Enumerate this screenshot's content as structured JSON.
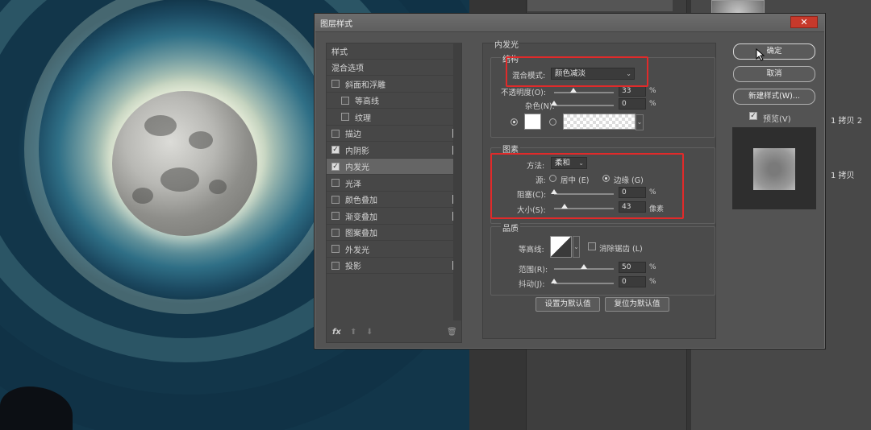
{
  "dialog": {
    "title": "图层样式",
    "close_icon": "close-icon"
  },
  "style_list": {
    "header": "样式",
    "items": [
      {
        "label": "混合选项",
        "checkbox": false,
        "checked": false,
        "plus": false,
        "indent": false,
        "selected": false
      },
      {
        "label": "斜面和浮雕",
        "checkbox": true,
        "checked": false,
        "plus": false,
        "indent": false,
        "selected": false
      },
      {
        "label": "等高线",
        "checkbox": true,
        "checked": false,
        "plus": false,
        "indent": true,
        "selected": false
      },
      {
        "label": "纹理",
        "checkbox": true,
        "checked": false,
        "plus": false,
        "indent": true,
        "selected": false
      },
      {
        "label": "描边",
        "checkbox": true,
        "checked": false,
        "plus": true,
        "indent": false,
        "selected": false
      },
      {
        "label": "内阴影",
        "checkbox": true,
        "checked": true,
        "plus": true,
        "indent": false,
        "selected": false
      },
      {
        "label": "内发光",
        "checkbox": true,
        "checked": true,
        "plus": false,
        "indent": false,
        "selected": true
      },
      {
        "label": "光泽",
        "checkbox": true,
        "checked": false,
        "plus": false,
        "indent": false,
        "selected": false
      },
      {
        "label": "颜色叠加",
        "checkbox": true,
        "checked": false,
        "plus": true,
        "indent": false,
        "selected": false
      },
      {
        "label": "渐变叠加",
        "checkbox": true,
        "checked": false,
        "plus": true,
        "indent": false,
        "selected": false
      },
      {
        "label": "图案叠加",
        "checkbox": true,
        "checked": false,
        "plus": false,
        "indent": false,
        "selected": false
      },
      {
        "label": "外发光",
        "checkbox": true,
        "checked": false,
        "plus": false,
        "indent": false,
        "selected": false
      },
      {
        "label": "投影",
        "checkbox": true,
        "checked": false,
        "plus": true,
        "indent": false,
        "selected": false
      }
    ],
    "footer": {
      "fx_label": "fx",
      "up_icon": "arrow-up-icon",
      "down_icon": "arrow-down-icon",
      "trash_icon": "trash-icon"
    }
  },
  "inner_glow": {
    "title": "内发光",
    "structure": {
      "title": "结构",
      "blend_mode_label": "混合模式:",
      "blend_mode_value": "颜色减淡",
      "opacity_label": "不透明度(O):",
      "opacity_value": "33",
      "opacity_unit": "%",
      "noise_label": "杂色(N):",
      "noise_value": "0",
      "noise_unit": "%"
    },
    "elements": {
      "title": "图素",
      "method_label": "方法:",
      "method_value": "柔和",
      "source_label": "源:",
      "source_center": "居中 (E)",
      "source_edge": "边缘 (G)",
      "choke_label": "阻塞(C):",
      "choke_value": "0",
      "choke_unit": "%",
      "size_label": "大小(S):",
      "size_value": "43",
      "size_unit": "像素"
    },
    "quality": {
      "title": "品质",
      "contour_label": "等高线:",
      "antialias_label": "消除锯齿 (L)",
      "range_label": "范围(R):",
      "range_value": "50",
      "range_unit": "%",
      "jitter_label": "抖动(J):",
      "jitter_value": "0",
      "jitter_unit": "%"
    },
    "buttons": {
      "set_default": "设置为默认值",
      "reset_default": "复位为默认值"
    },
    "slider_levels": {
      "opacity": 0.33,
      "noise": 0,
      "choke": 0,
      "size": 0.172,
      "range": 0.5,
      "jitter": 0
    }
  },
  "right_panel": {
    "ok": "确定",
    "cancel": "取消",
    "new_style": "新建样式(W)...",
    "preview_label": "预览(V)",
    "preview_checked": true
  },
  "background_panel": {
    "layer1": "1 拷贝 2",
    "layer2": "1 拷贝"
  },
  "colors": {
    "highlight_red": "#e12a2a",
    "dialog_bg": "#535353"
  }
}
